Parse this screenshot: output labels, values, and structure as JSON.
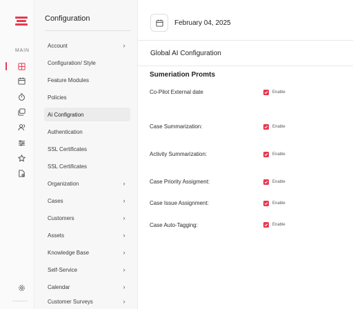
{
  "rail": {
    "section_label": "MAIN",
    "icons": [
      "grid-icon",
      "calendar-icon",
      "timer-icon",
      "gallery-icon",
      "users-icon",
      "sliders-icon",
      "star-icon",
      "document-settings-icon"
    ],
    "bottom_icon": "gear-icon"
  },
  "menu": {
    "title": "Configuration",
    "items": [
      {
        "label": "Account",
        "chevron": true
      },
      {
        "label": "Configuration/ Style",
        "chevron": false
      },
      {
        "label": "Feature Modules",
        "chevron": false
      },
      {
        "label": "Policies",
        "chevron": false
      },
      {
        "label": "Ai Configration",
        "chevron": false,
        "active": true
      },
      {
        "label": "Authentication",
        "chevron": false
      },
      {
        "label": "SSL Certificates",
        "chevron": false
      },
      {
        "label": "SSL Certificates",
        "chevron": false
      },
      {
        "label": "Organization",
        "chevron": true
      },
      {
        "label": "Cases",
        "chevron": true
      },
      {
        "label": "Customers",
        "chevron": true
      },
      {
        "label": "Assets",
        "chevron": true
      },
      {
        "label": "Knowledge Base",
        "chevron": true
      },
      {
        "label": "Self-Service",
        "chevron": true
      },
      {
        "label": "Calendar",
        "chevron": true
      },
      {
        "label": "Customer Surveys",
        "chevron": true
      }
    ]
  },
  "main": {
    "date": "February 04, 2025",
    "section_title": "Global AI Configuration",
    "subsection_title": "Sumeriation Promts",
    "rows": [
      {
        "label": "Co-Pilot External date",
        "toggle_label": "Enable",
        "checked": true
      },
      {
        "label": "Case Summarization:",
        "toggle_label": "Enable",
        "checked": true
      },
      {
        "label": "Activity Summarization:",
        "toggle_label": "Enable",
        "checked": true
      },
      {
        "label": "Case Priority Assigment:",
        "toggle_label": "Enable",
        "checked": true
      },
      {
        "label": "Case Issue Assignment:",
        "toggle_label": "Enable",
        "checked": true
      },
      {
        "label": "Case Auto-Tagging:",
        "toggle_label": "Enable",
        "checked": true
      }
    ]
  },
  "colors": {
    "accent": "#e8384f"
  }
}
